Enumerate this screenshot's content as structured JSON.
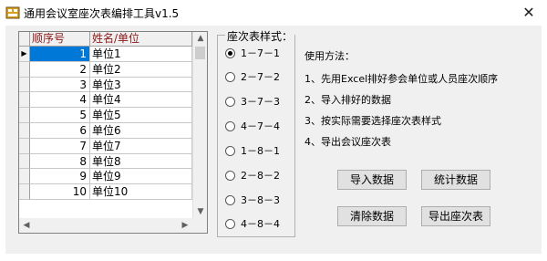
{
  "window": {
    "title": "通用会议室座次表编排工具v1.5",
    "close_glyph": "✕"
  },
  "grid": {
    "headers": {
      "seq": "顺序号",
      "name": "姓名/单位"
    },
    "rows": [
      {
        "seq": "1",
        "name": "单位1"
      },
      {
        "seq": "2",
        "name": "单位2"
      },
      {
        "seq": "3",
        "name": "单位3"
      },
      {
        "seq": "4",
        "name": "单位4"
      },
      {
        "seq": "5",
        "name": "单位5"
      },
      {
        "seq": "6",
        "name": "单位6"
      },
      {
        "seq": "7",
        "name": "单位7"
      },
      {
        "seq": "8",
        "name": "单位8"
      },
      {
        "seq": "9",
        "name": "单位9"
      },
      {
        "seq": "10",
        "name": "单位10"
      }
    ],
    "selected_row": 0,
    "row_pointer": "▶"
  },
  "layout_group": {
    "label": "座次表样式：",
    "options": [
      "1－7－1",
      "2－7－2",
      "3－7－3",
      "4－7－4",
      "1－8－1",
      "2－8－2",
      "3－8－3",
      "4－8－4"
    ],
    "selected": 0
  },
  "instructions": {
    "heading": "使用方法：",
    "steps": [
      "1、先用Excel排好参会单位或人员座次顺序",
      "2、导入排好的数据",
      "3、按实际需要选择座次表样式",
      "4、导出会议座次表"
    ]
  },
  "buttons": {
    "import": "导入数据",
    "stats": "统计数据",
    "clear": "清除数据",
    "export": "导出座次表"
  },
  "colors": {
    "header_text": "#8b1a1a",
    "selection": "#0078d7"
  }
}
